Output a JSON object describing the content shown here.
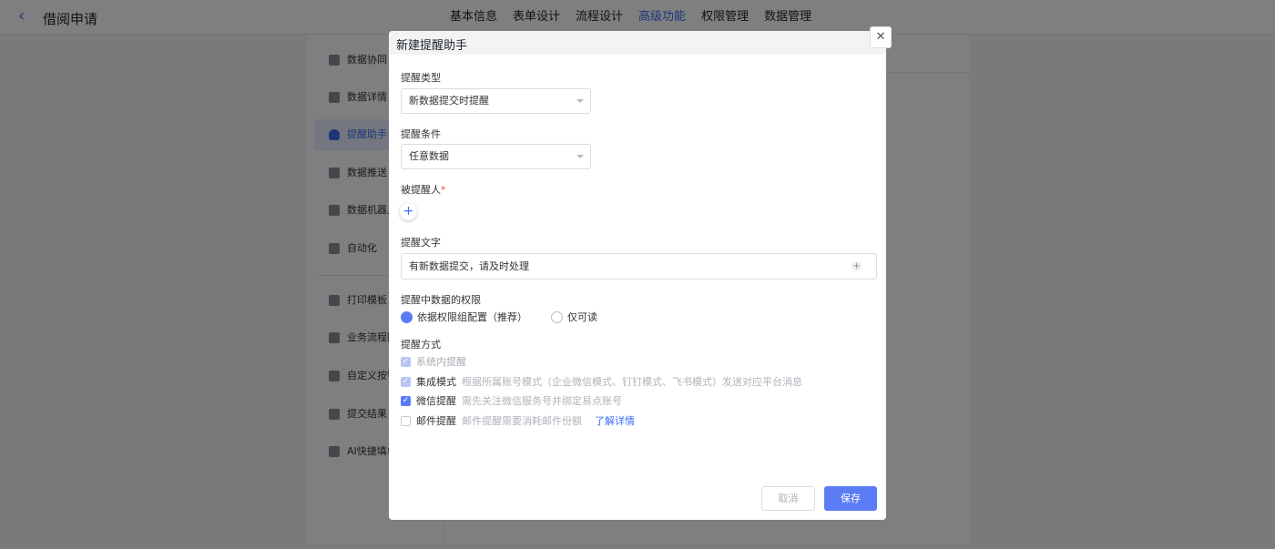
{
  "header": {
    "back_icon": "chevron-left-icon",
    "title": "借阅申请",
    "tabs": [
      {
        "label": "基本信息"
      },
      {
        "label": "表单设计"
      },
      {
        "label": "流程设计"
      },
      {
        "label": "高级功能",
        "active": true
      },
      {
        "label": "权限管理"
      },
      {
        "label": "数据管理"
      }
    ]
  },
  "sidebar": {
    "items": [
      {
        "label": "数据协同",
        "icon": "share-icon"
      },
      {
        "label": "数据详情",
        "icon": "detail-icon"
      },
      {
        "label": "提醒助手",
        "icon": "bell-icon",
        "active": true
      },
      {
        "label": "数据推送",
        "icon": "send-icon"
      },
      {
        "label": "数据机器人",
        "icon": "robot-icon"
      },
      {
        "label": "自动化",
        "icon": "automation-icon"
      },
      {
        "label": "打印模板",
        "icon": "print-icon"
      },
      {
        "label": "业务流程图",
        "icon": "flow-icon"
      },
      {
        "label": "自定义按钮",
        "icon": "button-icon"
      },
      {
        "label": "提交结果",
        "icon": "result-icon"
      },
      {
        "label": "AI快捷填单",
        "icon": "ai-icon"
      }
    ]
  },
  "modal": {
    "title": "新建提醒助手",
    "close_icon": "close-icon",
    "reminder_type": {
      "label": "提醒类型",
      "value": "新数据提交时提醒"
    },
    "reminder_condition": {
      "label": "提醒条件",
      "value": "任意数据"
    },
    "recipients": {
      "label": "被提醒人",
      "required_mark": "*"
    },
    "reminder_text": {
      "label": "提醒文字",
      "value": "有新数据提交，请及时处理"
    },
    "permission": {
      "label": "提醒中数据的权限",
      "options": [
        {
          "label": "依据权限组配置（推荐）",
          "selected": true
        },
        {
          "label": "仅可读",
          "selected": false
        }
      ]
    },
    "methods": {
      "label": "提醒方式",
      "items": [
        {
          "name": "系统内提醒",
          "desc": "",
          "checked": true,
          "disabled": true
        },
        {
          "name": "集成模式",
          "desc": "根据所属账号模式（企业微信模式、钉钉模式、飞书模式）发送对应平台消息",
          "checked": true,
          "disabled": true
        },
        {
          "name": "微信提醒",
          "desc": "需先关注微信服务号并绑定易点账号",
          "checked": true,
          "disabled": false
        },
        {
          "name": "邮件提醒",
          "desc": "邮件提醒需要消耗邮件份额",
          "checked": false,
          "disabled": false,
          "link": "了解详情"
        }
      ]
    },
    "cancel_label": "取消",
    "save_label": "保存"
  },
  "colors": {
    "accent": "#3b6cf6",
    "primary_button": "#5b7cf5",
    "overlay": "rgba(0,0,0,0.5)"
  }
}
